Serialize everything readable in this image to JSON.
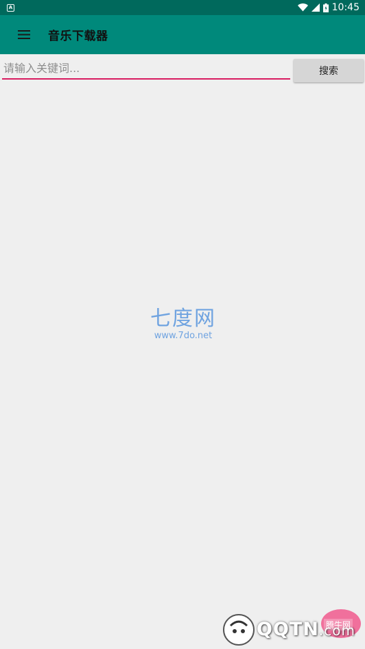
{
  "status_bar": {
    "time": "10:45",
    "notification_icon": "A"
  },
  "app_bar": {
    "title": "音乐下载器",
    "menu_icon": "hamburger-menu-icon",
    "color": "#00897b"
  },
  "search": {
    "placeholder": "请输入关键词...",
    "value": "",
    "button_label": "搜索",
    "underline_color": "#d81b60"
  },
  "watermark": {
    "title": "七度网",
    "url": "www.7do.net"
  },
  "bottom_logo": {
    "text": "QQTN",
    "suffix": ".com",
    "badge": "腾牛网"
  }
}
